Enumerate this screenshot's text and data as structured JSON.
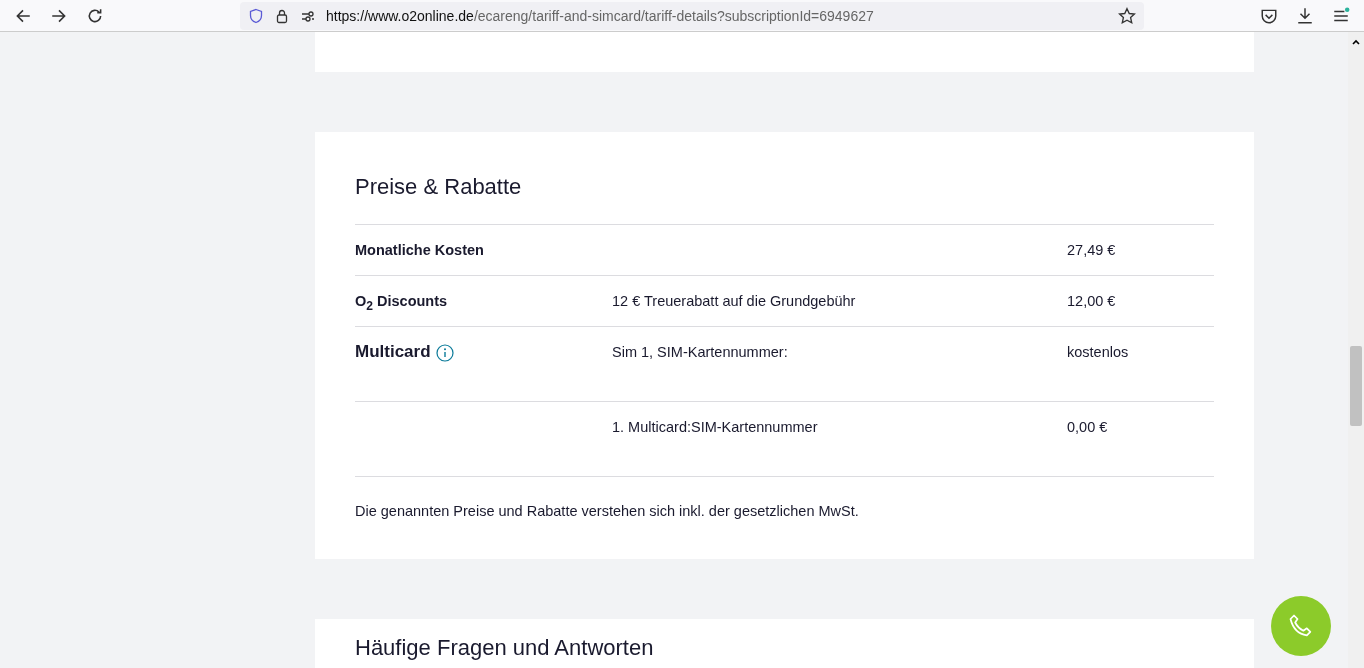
{
  "browser": {
    "url_host": "https://www.o2online.de",
    "url_path": "/ecareng/tariff-and-simcard/tariff-details?subscriptionId=6949627",
    "menu_notification": true
  },
  "prices": {
    "title": "Preise & Rabatte",
    "rows": [
      {
        "label": "Monatliche Kosten",
        "kind": "bold",
        "amount": "27,49 €",
        "info": false
      },
      {
        "label": "O$_{2}$ Discounts",
        "kind": "bold",
        "description": "12 € Treuerabatt auf die Grundgebühr",
        "amount": "12,00 €",
        "info": false
      },
      {
        "label": "Multicard",
        "kind": "large",
        "description": "Sim 1, SIM-Kartennummer:",
        "amount": "kostenlos",
        "info": true
      },
      {
        "description": "1. Multicard:SIM-Kartennummer",
        "amount": "0,00 €",
        "info": false
      }
    ],
    "note": "Die genannten Preise und Rabatte verstehen sich inkl. der gesetzlichen MwSt."
  },
  "faq": {
    "title": "Häufige Fragen und Antworten"
  }
}
